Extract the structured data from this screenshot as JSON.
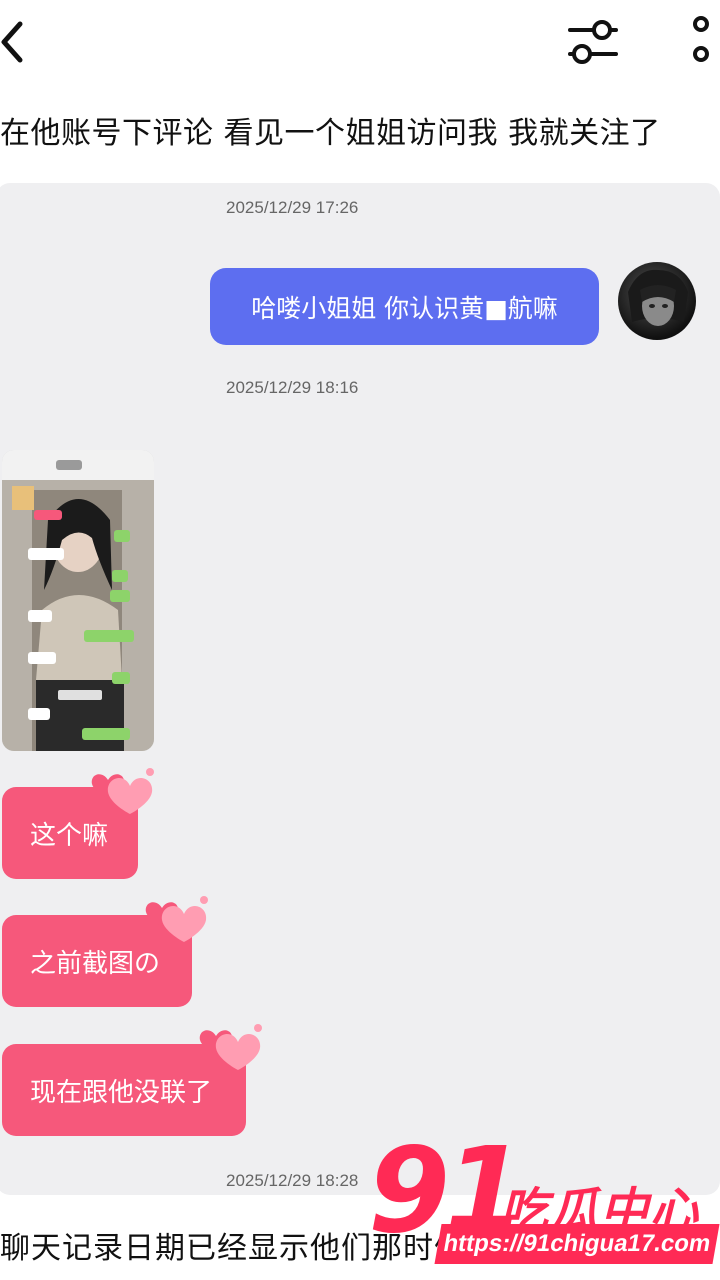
{
  "header": {
    "back_icon": "chevron-left-icon",
    "filter_icon": "sliders-icon",
    "more_icon": "more-vertical-icon"
  },
  "caption": "在他账号下评论 看见一个姐姐访问我 我就关注了",
  "chat": {
    "timestamps": [
      "2025/12/29 17:26",
      "2025/12/29 18:16",
      "2025/12/29 18:28"
    ],
    "outgoing_message": "哈喽小姐姐 你认识黄■航嘛",
    "incoming_messages": [
      "这个嘛",
      "之前截图の",
      "现在跟他没联了"
    ]
  },
  "bottom_text": "聊天记录日期已经显示他们那时候还在一起",
  "watermark": {
    "number": "91",
    "title": "吃瓜中心",
    "url": "https://91chigua17.com"
  },
  "colors": {
    "outgoing_bubble": "#5d6ef0",
    "incoming_bubble": "#f6587b",
    "panel_bg": "#efeff1",
    "watermark": "#ff2a55"
  }
}
